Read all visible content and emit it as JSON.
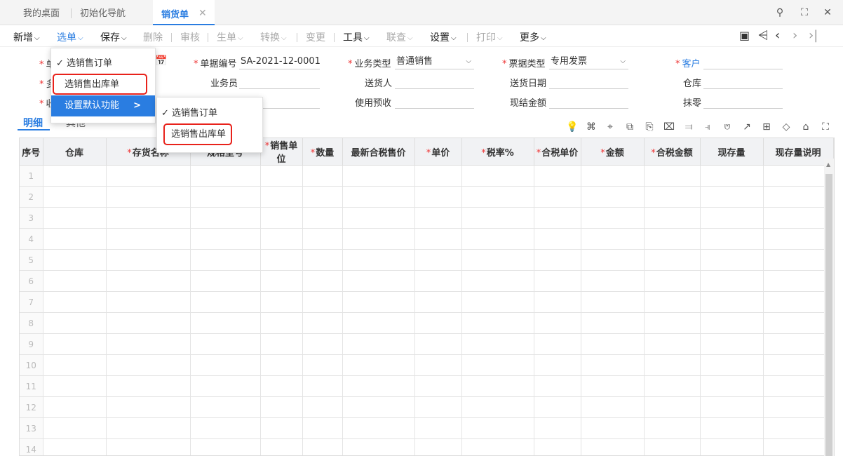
{
  "tabs": {
    "items": [
      "我的桌面",
      "初始化导航",
      "销货单"
    ],
    "close": "✕"
  },
  "window": {
    "search": "🔍",
    "maximize": "⛶",
    "close": "✕"
  },
  "toolbar": {
    "new": "新增",
    "select": "选单",
    "save": "保存",
    "delete": "删除",
    "audit": "审核",
    "generate": "生单",
    "convert": "转换",
    "change": "变更",
    "tools": "工具",
    "linkquery": "联查",
    "settings": "设置",
    "print": "打印",
    "more": "更多"
  },
  "nav": {
    "preview": "▣",
    "first": "|<",
    "prev": "<",
    "next": ">",
    "last": ">|"
  },
  "form": {
    "bill_no_label": "单据编号",
    "bill_no_value": "SA-2021-12-0001",
    "biz_type_label": "业务类型",
    "biz_type_value": "普通销售",
    "invoice_type_label": "票据类型",
    "invoice_type_value": "专用发票",
    "customer_label": "客户",
    "salesman_label": "业务员",
    "deliverer_label": "送货人",
    "delivery_date_label": "送货日期",
    "warehouse_label": "仓库",
    "use_prepay_label": "使用预收",
    "cash_amount_label": "现结金额",
    "wipe_label": "抹零",
    "partial_label_1": "单",
    "partial_label_2": "多",
    "partial_label_3": "收"
  },
  "subtabs": {
    "detail": "明细",
    "other": "其他"
  },
  "grid": {
    "columns": [
      {
        "label": "序号",
        "req": false
      },
      {
        "label": "仓库",
        "req": false
      },
      {
        "label": "存货名称",
        "req": true
      },
      {
        "label": "规格型号",
        "req": false
      },
      {
        "label": "销售单位",
        "req": true
      },
      {
        "label": "数量",
        "req": true
      },
      {
        "label": "最新合税售价",
        "req": false
      },
      {
        "label": "单价",
        "req": true
      },
      {
        "label": "税率%",
        "req": true
      },
      {
        "label": "合税单价",
        "req": true
      },
      {
        "label": "金额",
        "req": true
      },
      {
        "label": "合税金额",
        "req": true
      },
      {
        "label": "现存量",
        "req": false
      },
      {
        "label": "现存量说明",
        "req": false
      }
    ],
    "rows": [
      "1",
      "2",
      "3",
      "4",
      "5",
      "6",
      "7",
      "8",
      "9",
      "10",
      "11",
      "12",
      "13",
      "14"
    ]
  },
  "menu1": {
    "item1": "选销售订单",
    "item2": "选销售出库单",
    "item3": "设置默认功能",
    "arrow": ">",
    "check": "✓"
  },
  "menu2": {
    "item1": "选销售订单",
    "item2": "选销售出库单",
    "check": "✓"
  },
  "colors": {
    "accent": "#2a7de1",
    "required": "#e33",
    "highlight_box": "#e8221b"
  }
}
